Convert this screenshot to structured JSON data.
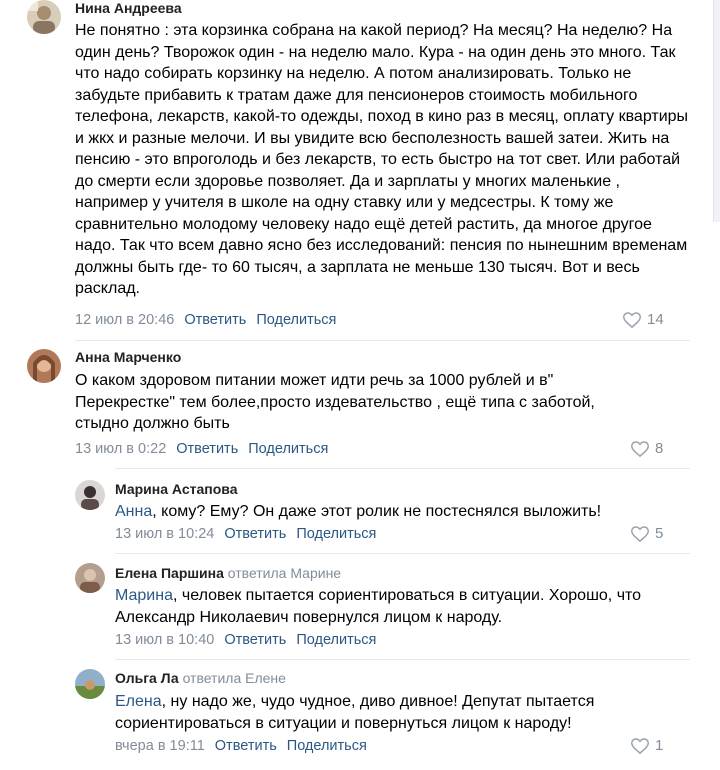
{
  "like_icon": "heart-outline-icon",
  "reply_label": "Ответить",
  "share_label": "Поделиться",
  "comments": [
    {
      "author": "Нина Андреева",
      "replied_to": "",
      "mention": "",
      "text": "Не понятно : эта корзинка собрана на какой период? На месяц? На неделю? На один день? Творожок один - на неделю мало. Кура - на один день это много. Так что надо собирать корзинку на неделю. А потом анализировать. Только не забудьте прибавить к тратам даже для пенсионеров стоимость мобильного телефона, лекарств, какой-то одежды, поход в кино раз в месяц, оплату квартиры и жкх и разные мелочи. И вы увидите всю бесполезность вашей затеи. Жить на пенсию - это впроголодь и без лекарств, то есть быстро на тот свет. Или работай до смерти если здоровье позволяет. Да и зарплаты у многих маленькие , например у учителя в школе на одну ставку или у медсестры. К тому же сравнительно молодому человеку надо ещё детей растить, да многое другое надо. Так что всем давно ясно без исследований: пенсия по нынешним временам должны быть где- то 60 тысяч, а зарплата не меньше 130 тысяч. Вот и весь расклад.",
      "date": "12 июл в 20:46",
      "likes": "14"
    },
    {
      "author": "Анна Марченко",
      "replied_to": "",
      "mention": "",
      "text": "О каком здоровом питании может идти речь за 1000 рублей и в\" Перекрестке\" тем более,просто издевательство , ещё типа с заботой, стыдно должно быть",
      "date": "13 июл в 0:22",
      "likes": "8"
    },
    {
      "author": "Марина Астапова",
      "replied_to": "",
      "mention": "Анна",
      "text": ", кому? Ему? Он даже этот ролик не постеснялся выложить!",
      "date": "13 июл в 10:24",
      "likes": "5"
    },
    {
      "author": "Елена Паршина",
      "replied_to": "ответила Марине",
      "mention": "Марина",
      "text": ", человек пытается сориентироваться в ситуации. Хорошо, что Александр Николаевич повернулся лицом к народу.",
      "date": "13 июл в 10:40",
      "likes": ""
    },
    {
      "author": "Ольга Ла",
      "replied_to": "ответила Елене",
      "mention": "Елена",
      "text": ", ну надо же, чудо чудное, диво дивное! Депутат пытается сориентироваться в ситуации и повернуться лицом к народу!",
      "date": "вчера в 19:11",
      "likes": "1"
    }
  ]
}
